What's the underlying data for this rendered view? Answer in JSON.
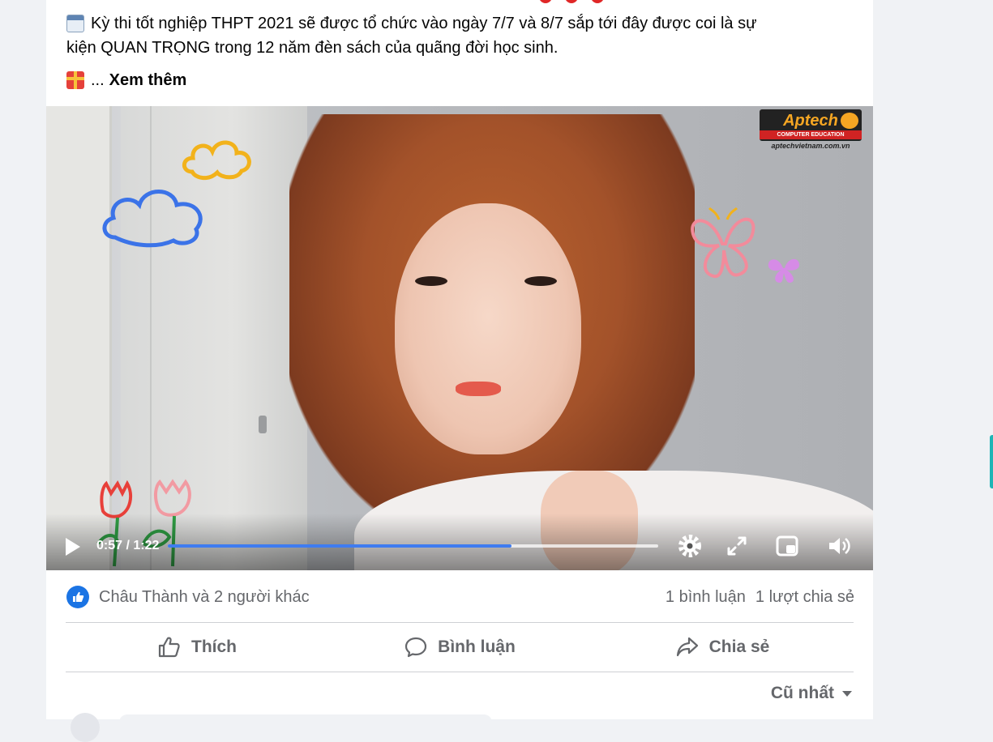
{
  "post": {
    "text_line1": "Kỳ thi tốt nghiệp THPT 2021 sẽ được tổ chức vào ngày 7/7 và 8/7 sắp tới đây được coi là sự",
    "text_line2": "kiện QUAN TRỌNG trong 12 năm đèn sách của quãng đời học sinh.",
    "ellipsis": "...",
    "see_more": "Xem thêm",
    "icons": [
      "calendar-emoji",
      "gift-emoji"
    ]
  },
  "video": {
    "watermark": {
      "brand": "Aptech",
      "tagline": "COMPUTER EDUCATION",
      "url": "aptechvietnam.com.vn",
      "trademark": "™"
    },
    "time": "0:57 / 1:22",
    "progress": 0.7,
    "controls": [
      "play-icon",
      "settings-icon",
      "fullscreen-icon",
      "mini-player-icon",
      "volume-icon"
    ]
  },
  "reactions": {
    "likers": "Châu Thành và 2 người khác",
    "comments": "1 bình luận",
    "shares": "1 lượt chia sẻ"
  },
  "actions": {
    "like": "Thích",
    "comment": "Bình luận",
    "share": "Chia sẻ"
  },
  "comments_sort": "Cũ nhất",
  "colors": {
    "accent": "#1b74e4",
    "progress": "#3f7cf0",
    "text": "#050505",
    "muted": "#65676b"
  }
}
